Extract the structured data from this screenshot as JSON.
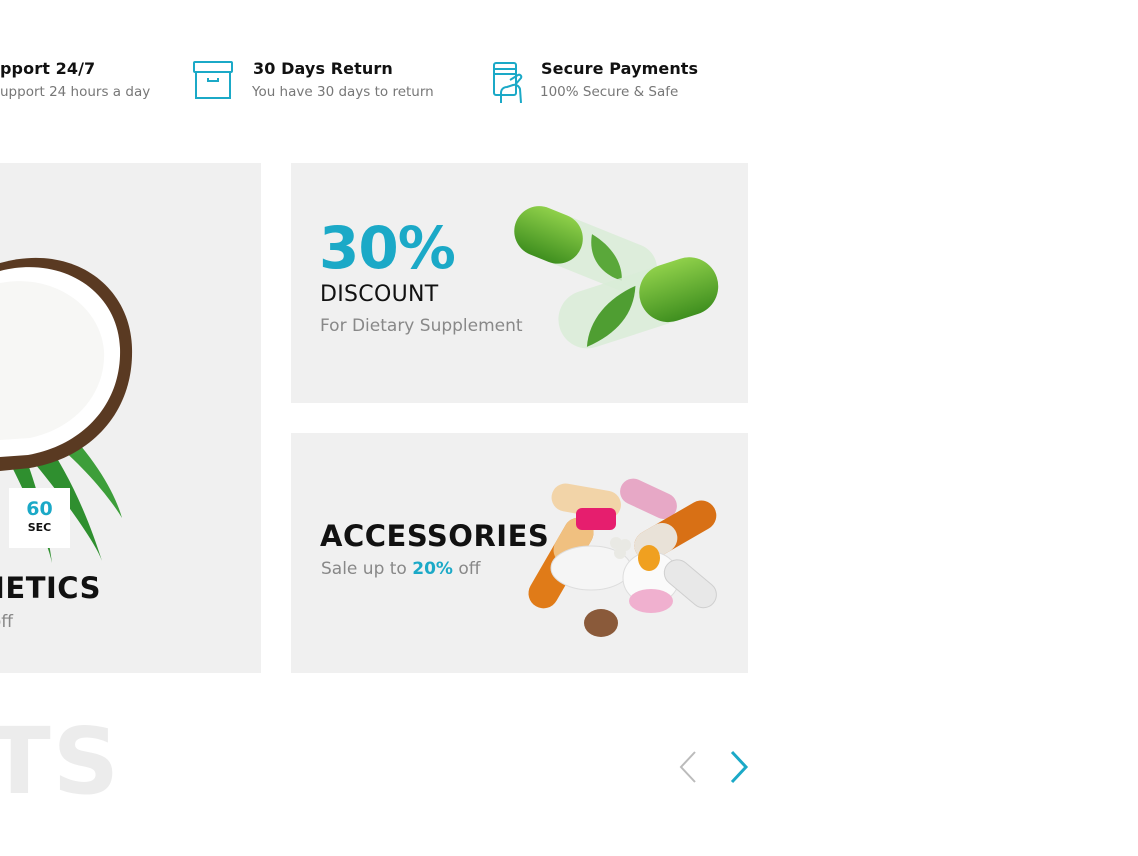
{
  "features": [
    {
      "icon": "support-icon",
      "title": "pport 24/7",
      "subtitle": "upport 24 hours a day"
    },
    {
      "icon": "box-icon",
      "title": "30 Days Return",
      "subtitle": "You have 30 days to return"
    },
    {
      "icon": "secure-card-icon",
      "title": "Secure Payments",
      "subtitle": "100% Secure & Safe"
    }
  ],
  "banners": {
    "cosmetics": {
      "title": "METICS",
      "subtitle": "off",
      "countdown": {
        "value": "60",
        "unit": "SEC"
      }
    },
    "discount": {
      "percent": "30%",
      "title": "DISCOUNT",
      "subtitle": "For Dietary Supplement"
    },
    "accessories": {
      "title": "ACCESSORIES",
      "subtitle_prefix": "Sale up to ",
      "subtitle_highlight": "20%",
      "subtitle_suffix": " off"
    }
  },
  "section": {
    "title_fragment": "TS"
  },
  "carousel": {
    "prev_icon": "chevron-left-icon",
    "next_icon": "chevron-right-icon"
  },
  "colors": {
    "accent": "#1ba9c7",
    "banner_bg": "#f0f0f0",
    "text_dark": "#111111",
    "text_muted": "#888888"
  }
}
